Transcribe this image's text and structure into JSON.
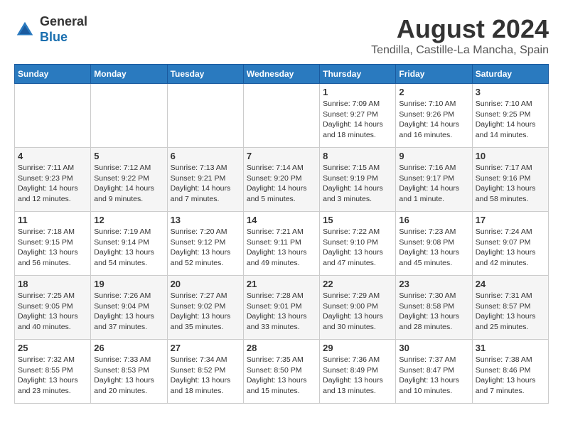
{
  "header": {
    "logo_general": "General",
    "logo_blue": "Blue",
    "month_year": "August 2024",
    "location": "Tendilla, Castille-La Mancha, Spain"
  },
  "calendar": {
    "days_of_week": [
      "Sunday",
      "Monday",
      "Tuesday",
      "Wednesday",
      "Thursday",
      "Friday",
      "Saturday"
    ],
    "weeks": [
      [
        {
          "day": "",
          "info": ""
        },
        {
          "day": "",
          "info": ""
        },
        {
          "day": "",
          "info": ""
        },
        {
          "day": "",
          "info": ""
        },
        {
          "day": "1",
          "info": "Sunrise: 7:09 AM\nSunset: 9:27 PM\nDaylight: 14 hours\nand 18 minutes."
        },
        {
          "day": "2",
          "info": "Sunrise: 7:10 AM\nSunset: 9:26 PM\nDaylight: 14 hours\nand 16 minutes."
        },
        {
          "day": "3",
          "info": "Sunrise: 7:10 AM\nSunset: 9:25 PM\nDaylight: 14 hours\nand 14 minutes."
        }
      ],
      [
        {
          "day": "4",
          "info": "Sunrise: 7:11 AM\nSunset: 9:23 PM\nDaylight: 14 hours\nand 12 minutes."
        },
        {
          "day": "5",
          "info": "Sunrise: 7:12 AM\nSunset: 9:22 PM\nDaylight: 14 hours\nand 9 minutes."
        },
        {
          "day": "6",
          "info": "Sunrise: 7:13 AM\nSunset: 9:21 PM\nDaylight: 14 hours\nand 7 minutes."
        },
        {
          "day": "7",
          "info": "Sunrise: 7:14 AM\nSunset: 9:20 PM\nDaylight: 14 hours\nand 5 minutes."
        },
        {
          "day": "8",
          "info": "Sunrise: 7:15 AM\nSunset: 9:19 PM\nDaylight: 14 hours\nand 3 minutes."
        },
        {
          "day": "9",
          "info": "Sunrise: 7:16 AM\nSunset: 9:17 PM\nDaylight: 14 hours\nand 1 minute."
        },
        {
          "day": "10",
          "info": "Sunrise: 7:17 AM\nSunset: 9:16 PM\nDaylight: 13 hours\nand 58 minutes."
        }
      ],
      [
        {
          "day": "11",
          "info": "Sunrise: 7:18 AM\nSunset: 9:15 PM\nDaylight: 13 hours\nand 56 minutes."
        },
        {
          "day": "12",
          "info": "Sunrise: 7:19 AM\nSunset: 9:14 PM\nDaylight: 13 hours\nand 54 minutes."
        },
        {
          "day": "13",
          "info": "Sunrise: 7:20 AM\nSunset: 9:12 PM\nDaylight: 13 hours\nand 52 minutes."
        },
        {
          "day": "14",
          "info": "Sunrise: 7:21 AM\nSunset: 9:11 PM\nDaylight: 13 hours\nand 49 minutes."
        },
        {
          "day": "15",
          "info": "Sunrise: 7:22 AM\nSunset: 9:10 PM\nDaylight: 13 hours\nand 47 minutes."
        },
        {
          "day": "16",
          "info": "Sunrise: 7:23 AM\nSunset: 9:08 PM\nDaylight: 13 hours\nand 45 minutes."
        },
        {
          "day": "17",
          "info": "Sunrise: 7:24 AM\nSunset: 9:07 PM\nDaylight: 13 hours\nand 42 minutes."
        }
      ],
      [
        {
          "day": "18",
          "info": "Sunrise: 7:25 AM\nSunset: 9:05 PM\nDaylight: 13 hours\nand 40 minutes."
        },
        {
          "day": "19",
          "info": "Sunrise: 7:26 AM\nSunset: 9:04 PM\nDaylight: 13 hours\nand 37 minutes."
        },
        {
          "day": "20",
          "info": "Sunrise: 7:27 AM\nSunset: 9:02 PM\nDaylight: 13 hours\nand 35 minutes."
        },
        {
          "day": "21",
          "info": "Sunrise: 7:28 AM\nSunset: 9:01 PM\nDaylight: 13 hours\nand 33 minutes."
        },
        {
          "day": "22",
          "info": "Sunrise: 7:29 AM\nSunset: 9:00 PM\nDaylight: 13 hours\nand 30 minutes."
        },
        {
          "day": "23",
          "info": "Sunrise: 7:30 AM\nSunset: 8:58 PM\nDaylight: 13 hours\nand 28 minutes."
        },
        {
          "day": "24",
          "info": "Sunrise: 7:31 AM\nSunset: 8:57 PM\nDaylight: 13 hours\nand 25 minutes."
        }
      ],
      [
        {
          "day": "25",
          "info": "Sunrise: 7:32 AM\nSunset: 8:55 PM\nDaylight: 13 hours\nand 23 minutes."
        },
        {
          "day": "26",
          "info": "Sunrise: 7:33 AM\nSunset: 8:53 PM\nDaylight: 13 hours\nand 20 minutes."
        },
        {
          "day": "27",
          "info": "Sunrise: 7:34 AM\nSunset: 8:52 PM\nDaylight: 13 hours\nand 18 minutes."
        },
        {
          "day": "28",
          "info": "Sunrise: 7:35 AM\nSunset: 8:50 PM\nDaylight: 13 hours\nand 15 minutes."
        },
        {
          "day": "29",
          "info": "Sunrise: 7:36 AM\nSunset: 8:49 PM\nDaylight: 13 hours\nand 13 minutes."
        },
        {
          "day": "30",
          "info": "Sunrise: 7:37 AM\nSunset: 8:47 PM\nDaylight: 13 hours\nand 10 minutes."
        },
        {
          "day": "31",
          "info": "Sunrise: 7:38 AM\nSunset: 8:46 PM\nDaylight: 13 hours\nand 7 minutes."
        }
      ]
    ]
  }
}
